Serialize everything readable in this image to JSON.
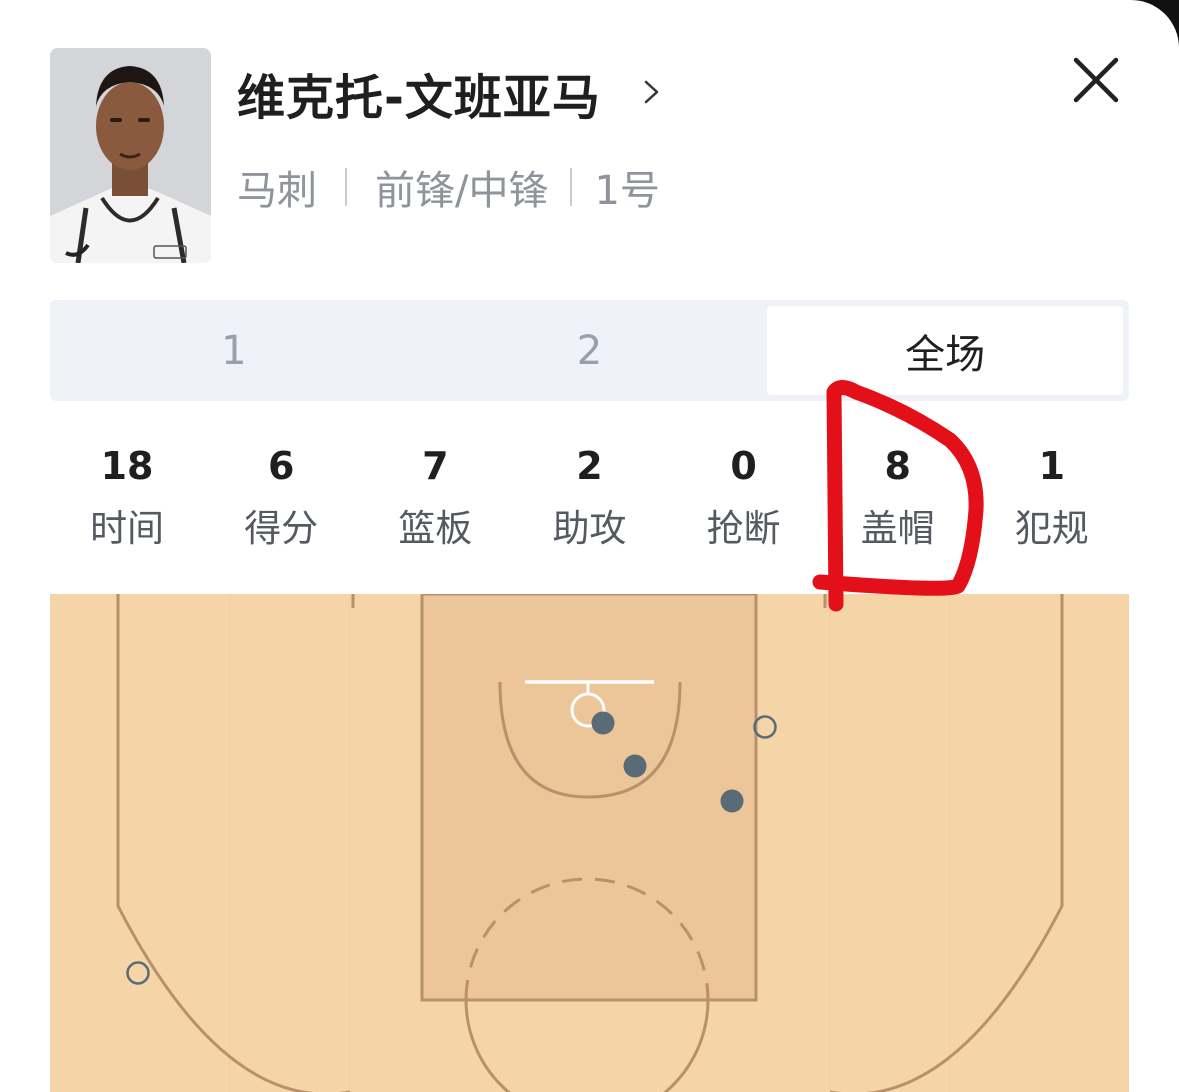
{
  "player": {
    "name": "维克托-文班亚马",
    "team": "马刺",
    "position": "前锋/中锋",
    "number": "1号"
  },
  "tabs": [
    {
      "label": "1",
      "active": false
    },
    {
      "label": "2",
      "active": false
    },
    {
      "label": "全场",
      "active": true
    }
  ],
  "stats": [
    {
      "value": "18",
      "label": "时间"
    },
    {
      "value": "6",
      "label": "得分"
    },
    {
      "value": "7",
      "label": "篮板"
    },
    {
      "value": "2",
      "label": "助攻"
    },
    {
      "value": "0",
      "label": "抢断"
    },
    {
      "value": "8",
      "label": "盖帽"
    },
    {
      "value": "1",
      "label": "犯规"
    }
  ],
  "shot_chart": {
    "shots": [
      {
        "result": "made"
      },
      {
        "result": "made"
      },
      {
        "result": "made"
      },
      {
        "result": "missed"
      },
      {
        "result": "missed"
      }
    ]
  },
  "colors": {
    "shot_marker": "#5a6b78",
    "court_wood": "#f5d4a8",
    "court_paint": "#ecc598",
    "court_line": "#b8916a",
    "annotation": "#e3101a"
  },
  "icons": {
    "name_chevron": "chevron-right-icon",
    "close": "close-icon"
  },
  "annotation": {
    "type": "hand-drawn red outline around 盖帽 stat"
  }
}
